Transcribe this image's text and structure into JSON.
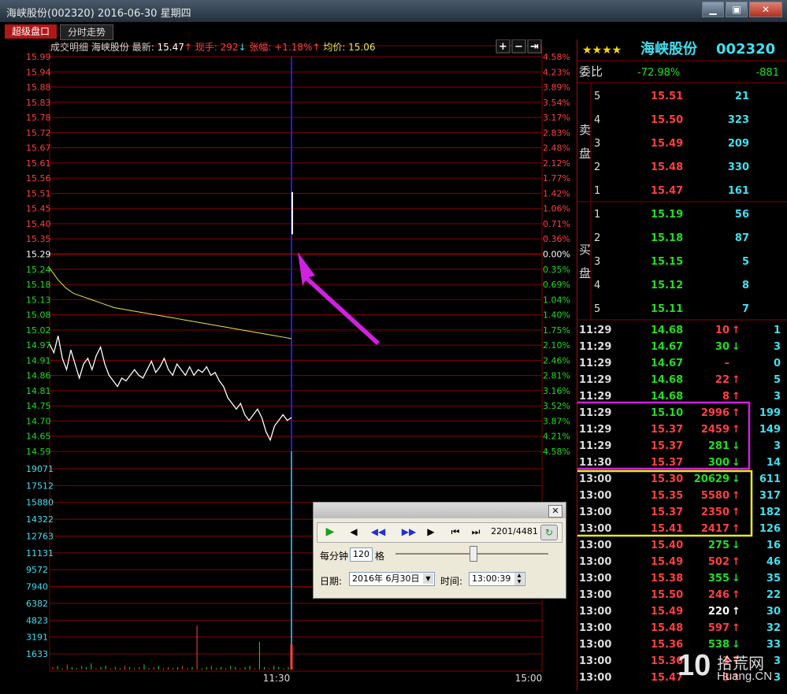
{
  "window": {
    "title": "海峡股份(002320) 2016-06-30 星期四",
    "btn_min": "▁",
    "btn_max": "▣",
    "btn_close": "✕"
  },
  "tabs": [
    {
      "label": "超级盘口"
    },
    {
      "label": "分时走势"
    }
  ],
  "chart_header": {
    "mode": "成交明细",
    "name": "海峡股份",
    "latest_label": "最新:",
    "latest": "15.47",
    "latest_arrow": "↑",
    "vol_label": "现手:",
    "vol": "292",
    "vol_arrow": "↓",
    "chg_label": "张幅:",
    "chg": "+1.18%",
    "chg_arrow": "↑",
    "avg_label": "均价:",
    "avg": "15.06"
  },
  "chart_tools": {
    "plus": "+",
    "minus": "−",
    "right": "⇥"
  },
  "price_axis": [
    "15.99",
    "15.94",
    "15.88",
    "15.83",
    "15.78",
    "15.72",
    "15.67",
    "15.61",
    "15.56",
    "15.51",
    "15.45",
    "15.40",
    "15.35",
    "15.29",
    "15.24",
    "15.18",
    "15.13",
    "15.08",
    "15.02",
    "14.97",
    "14.91",
    "14.86",
    "14.81",
    "14.75",
    "14.70",
    "14.65",
    "14.59"
  ],
  "pct_axis": [
    "4.58%",
    "4.23%",
    "3.89%",
    "3.54%",
    "3.17%",
    "2.83%",
    "2.48%",
    "2.12%",
    "1.77%",
    "1.42%",
    "1.06%",
    "0.71%",
    "0.36%",
    "0.00%",
    "0.35%",
    "0.69%",
    "1.04%",
    "1.40%",
    "1.75%",
    "2.10%",
    "2.46%",
    "2.81%",
    "3.16%",
    "3.52%",
    "3.87%",
    "4.21%",
    "4.58%"
  ],
  "volume_axis": [
    "19071",
    "17512",
    "15880",
    "14322",
    "12763",
    "11131",
    "9572",
    "7940",
    "6382",
    "4823",
    "3191",
    "1633"
  ],
  "time_axis": [
    "11:30",
    "15:00"
  ],
  "quote": {
    "stars": "★★★★",
    "name": "海峡股份",
    "code": "002320",
    "wei_label": "委比",
    "wei_pct": "-72.98%",
    "wei_diff": "-881",
    "sell_label": [
      "卖",
      "盘"
    ],
    "buy_label": [
      "买",
      "盘"
    ],
    "sell": [
      {
        "lvl": "5",
        "price": "15.51",
        "vol": "21"
      },
      {
        "lvl": "4",
        "price": "15.50",
        "vol": "323"
      },
      {
        "lvl": "3",
        "price": "15.49",
        "vol": "209"
      },
      {
        "lvl": "2",
        "price": "15.48",
        "vol": "330"
      },
      {
        "lvl": "1",
        "price": "15.47",
        "vol": "161"
      }
    ],
    "buy": [
      {
        "lvl": "1",
        "price": "15.19",
        "vol": "56"
      },
      {
        "lvl": "2",
        "price": "15.18",
        "vol": "87"
      },
      {
        "lvl": "3",
        "price": "15.15",
        "vol": "5"
      },
      {
        "lvl": "4",
        "price": "15.12",
        "vol": "8"
      },
      {
        "lvl": "5",
        "price": "15.11",
        "vol": "7"
      }
    ]
  },
  "ticks": [
    {
      "time": "11:29",
      "price": "14.68",
      "vol": "10",
      "arrow": "↑",
      "n": "1"
    },
    {
      "time": "11:29",
      "price": "14.67",
      "vol": "30",
      "arrow": "↓",
      "n": "3"
    },
    {
      "time": "11:29",
      "price": "14.67",
      "vol": "–",
      "arrow": "",
      "n": "0"
    },
    {
      "time": "11:29",
      "price": "14.68",
      "vol": "22",
      "arrow": "↑",
      "n": "5"
    },
    {
      "time": "11:29",
      "price": "14.68",
      "vol": "8",
      "arrow": "↑",
      "n": "3"
    },
    {
      "time": "11:29",
      "price": "15.10",
      "vol": "2996",
      "arrow": "↑",
      "n": "199"
    },
    {
      "time": "11:29",
      "price": "15.37",
      "vol": "2459",
      "arrow": "↑",
      "n": "149"
    },
    {
      "time": "11:29",
      "price": "15.37",
      "vol": "281",
      "arrow": "↓",
      "n": "3"
    },
    {
      "time": "11:30",
      "price": "15.37",
      "vol": "300",
      "arrow": "↓",
      "n": "14"
    },
    {
      "time": "13:00",
      "price": "15.30",
      "vol": "20629",
      "arrow": "↓",
      "n": "611"
    },
    {
      "time": "13:00",
      "price": "15.35",
      "vol": "5580",
      "arrow": "↑",
      "n": "317"
    },
    {
      "time": "13:00",
      "price": "15.37",
      "vol": "2350",
      "arrow": "↑",
      "n": "182"
    },
    {
      "time": "13:00",
      "price": "15.41",
      "vol": "2417",
      "arrow": "↑",
      "n": "126"
    },
    {
      "time": "13:00",
      "price": "15.40",
      "vol": "275",
      "arrow": "↓",
      "n": "16"
    },
    {
      "time": "13:00",
      "price": "15.49",
      "vol": "502",
      "arrow": "↑",
      "n": "46"
    },
    {
      "time": "13:00",
      "price": "15.38",
      "vol": "355",
      "arrow": "↓",
      "n": "35"
    },
    {
      "time": "13:00",
      "price": "15.50",
      "vol": "246",
      "arrow": "↑",
      "n": "22"
    },
    {
      "time": "13:00",
      "price": "15.49",
      "vol": "220",
      "arrow": "↑",
      "n": "30"
    },
    {
      "time": "13:00",
      "price": "15.48",
      "vol": "597",
      "arrow": "↑",
      "n": "32"
    },
    {
      "time": "13:00",
      "price": "15.36",
      "vol": "538",
      "arrow": "↓",
      "n": "33"
    },
    {
      "time": "13:00",
      "price": "15.36",
      "vol": "3",
      "arrow": "↑",
      "n": "3"
    },
    {
      "time": "13:00",
      "price": "15.47",
      "vol": "3",
      "arrow": "↑",
      "n": "3"
    }
  ],
  "replay": {
    "counter": "2201/4481",
    "per_min_label": "每分钟",
    "per_min_value": "120",
    "per_min_unit": "格",
    "date_label": "日期:",
    "date_value": "2016年 6月30日",
    "time_label": "时间:",
    "time_value": "13:00:39",
    "close": "✕"
  },
  "watermark": {
    "number": "10",
    "brand": "拾荒网",
    "url": "Huang.CN"
  },
  "colors": {
    "up": "#ff4040",
    "down": "#22dd22",
    "cyan": "#40e0f0",
    "avg_line": "#e8e84a",
    "grid": "#8a0000",
    "magenta_box": "#d020e0",
    "yellow_box": "#e8e820"
  }
}
